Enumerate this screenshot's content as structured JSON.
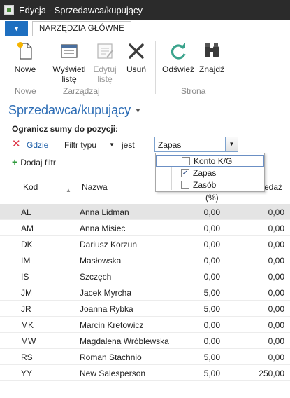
{
  "window": {
    "title": "Edycja - Sprzedawca/kupujący"
  },
  "ribbon": {
    "tab": "NARZĘDZIA GŁÓWNE",
    "buttons": {
      "new": "Nowe",
      "view_list_1": "Wyświetl",
      "view_list_2": "listę",
      "edit_list_1": "Edytuj",
      "edit_list_2": "listę",
      "delete": "Usuń",
      "refresh": "Odśwież",
      "find": "Znajdź"
    },
    "groups": {
      "new": "Nowe",
      "manage": "Zarządzaj",
      "page": "Strona"
    }
  },
  "page": {
    "title": "Sprzedawca/kupujący"
  },
  "filter": {
    "heading": "Ogranicz sumy do pozycji:",
    "where": "Gdzie",
    "field": "Filtr typu",
    "operator": "jest",
    "value": "Zapas",
    "add": "Dodaj filtr",
    "options": [
      {
        "label": "Konto K/G",
        "checked": false
      },
      {
        "label": "Zapas",
        "checked": true
      },
      {
        "label": "Zasób",
        "checked": false
      }
    ]
  },
  "grid": {
    "columns": {
      "code": "Kod",
      "name": "Nazwa",
      "pct_fragment": "(%)",
      "sales_fragment": "edaż"
    },
    "rows": [
      {
        "code": "AL",
        "name": "Anna Lidman",
        "pct": "0,00",
        "sales": "0,00"
      },
      {
        "code": "AM",
        "name": "Anna Misiec",
        "pct": "0,00",
        "sales": "0,00"
      },
      {
        "code": "DK",
        "name": "Dariusz Korzun",
        "pct": "0,00",
        "sales": "0,00"
      },
      {
        "code": "IM",
        "name": "Masłowska",
        "pct": "0,00",
        "sales": "0,00"
      },
      {
        "code": "IS",
        "name": "Szczęch",
        "pct": "0,00",
        "sales": "0,00"
      },
      {
        "code": "JM",
        "name": "Jacek Myrcha",
        "pct": "5,00",
        "sales": "0,00"
      },
      {
        "code": "JR",
        "name": "Joanna Rybka",
        "pct": "5,00",
        "sales": "0,00"
      },
      {
        "code": "MK",
        "name": "Marcin Kretowicz",
        "pct": "0,00",
        "sales": "0,00"
      },
      {
        "code": "MW",
        "name": "Magdalena Wróblewska",
        "pct": "0,00",
        "sales": "0,00"
      },
      {
        "code": "RS",
        "name": "Roman Stachnio",
        "pct": "5,00",
        "sales": "0,00"
      },
      {
        "code": "YY",
        "name": "New Salesperson",
        "pct": "5,00",
        "sales": "250,00"
      }
    ]
  },
  "colors": {
    "accent": "#2d6db5",
    "app_menu": "#1e6fc0",
    "titlebar": "#2b2b2b"
  }
}
